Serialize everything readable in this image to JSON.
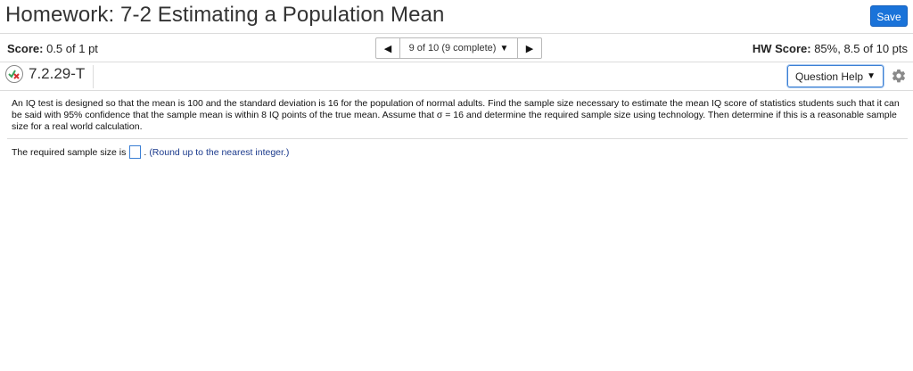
{
  "header": {
    "title": "Homework: 7-2 Estimating a Population Mean",
    "save_label": "Save"
  },
  "status": {
    "score_label": "Score:",
    "score_value": "0.5 of 1 pt",
    "nav_progress": "9 of 10 (9 complete)",
    "hw_score_label": "HW Score:",
    "hw_score_value": "85%, 8.5 of 10 pts"
  },
  "question": {
    "id": "7.2.29-T",
    "help_label": "Question Help",
    "text": "An IQ test is designed so that the mean is 100 and the standard deviation is 16 for the population of normal adults. Find the sample size necessary to estimate the mean IQ score of statistics students such that it can be said with 95% confidence that the sample mean is within 8 IQ points of the true mean. Assume that σ = 16 and determine the required sample size using technology. Then determine if this is a reasonable sample size for a real world calculation.",
    "answer_prefix": "The required sample size is",
    "answer_value": "",
    "answer_hint": "(Round up to the nearest integer.)"
  },
  "colors": {
    "accent": "#1a73d9",
    "hint_text": "#1b3a8c",
    "status_icon_check": "#3aa35a",
    "status_icon_x": "#d32f2f"
  },
  "icons": {
    "prev": "triangle-left-icon",
    "next": "triangle-right-icon",
    "dropdown": "triangle-down-icon",
    "settings": "gear-icon",
    "partial_credit": "partial-credit-icon"
  }
}
